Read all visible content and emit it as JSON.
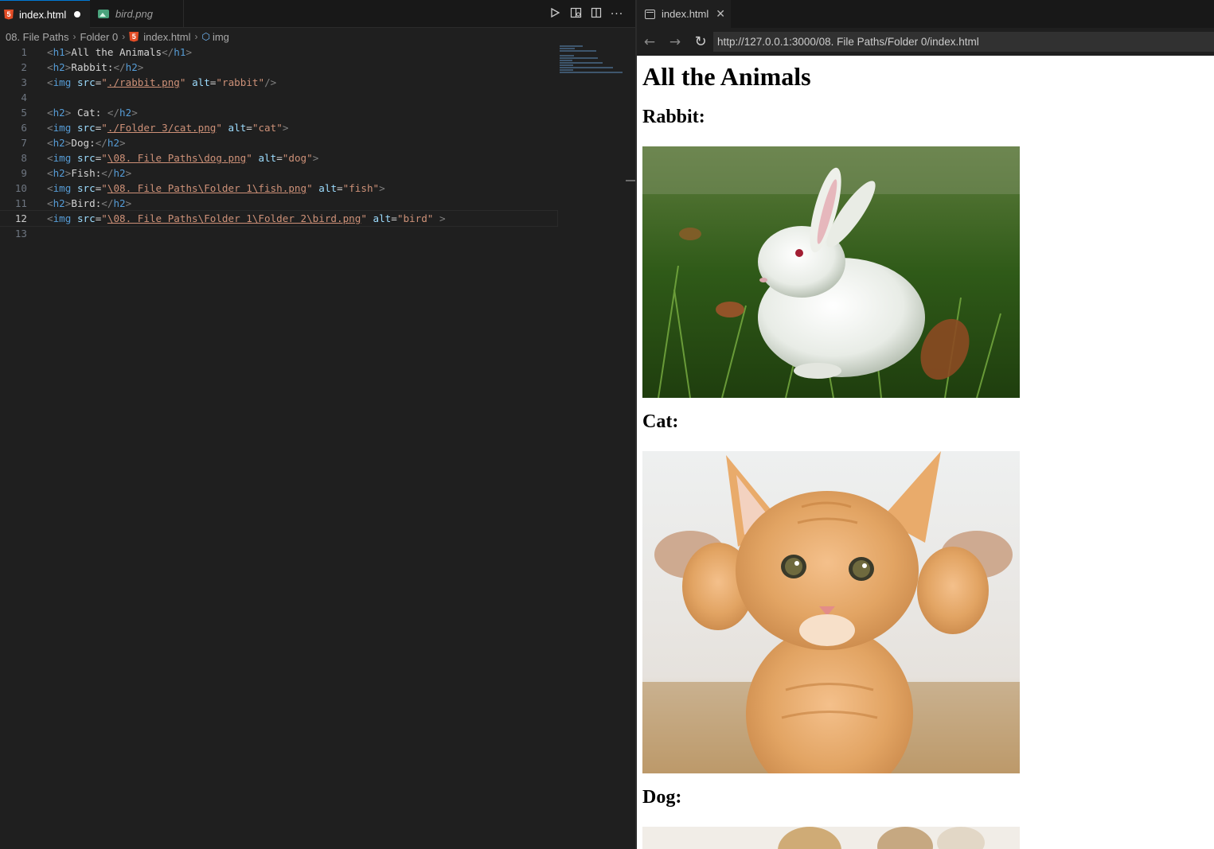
{
  "editor": {
    "tabs": [
      {
        "label": "index.html",
        "icon": "html5-icon",
        "dirty": true,
        "active": true
      },
      {
        "label": "bird.png",
        "icon": "image-file-icon",
        "active": false
      }
    ],
    "actions": [
      "run-icon",
      "open-preview-icon",
      "split-editor-icon",
      "more-actions-icon"
    ],
    "breadcrumb": [
      "08. File Paths",
      "Folder 0",
      "index.html",
      "img"
    ],
    "active_line": 12,
    "lines": [
      {
        "n": "1",
        "tokens": [
          [
            "br",
            "<"
          ],
          [
            "tag",
            "h1"
          ],
          [
            "br",
            ">"
          ],
          [
            "txt",
            "All the Animals"
          ],
          [
            "br",
            "</"
          ],
          [
            "tag",
            "h1"
          ],
          [
            "br",
            ">"
          ]
        ]
      },
      {
        "n": "2",
        "tokens": [
          [
            "br",
            "<"
          ],
          [
            "tag",
            "h2"
          ],
          [
            "br",
            ">"
          ],
          [
            "txt",
            "Rabbit:"
          ],
          [
            "br",
            "</"
          ],
          [
            "tag",
            "h2"
          ],
          [
            "br",
            ">"
          ]
        ]
      },
      {
        "n": "3",
        "tokens": [
          [
            "br",
            "<"
          ],
          [
            "tag",
            "img"
          ],
          [
            "txt",
            " "
          ],
          [
            "attr",
            "src"
          ],
          [
            "txt",
            "="
          ],
          [
            "str",
            "\""
          ],
          [
            "path",
            "./rabbit.png"
          ],
          [
            "str",
            "\""
          ],
          [
            "txt",
            " "
          ],
          [
            "attr",
            "alt"
          ],
          [
            "txt",
            "="
          ],
          [
            "str",
            "\"rabbit\""
          ],
          [
            "br",
            "/>"
          ]
        ]
      },
      {
        "n": "4",
        "tokens": []
      },
      {
        "n": "5",
        "tokens": [
          [
            "br",
            "<"
          ],
          [
            "tag",
            "h2"
          ],
          [
            "br",
            ">"
          ],
          [
            "txt",
            " Cat: "
          ],
          [
            "br",
            "</"
          ],
          [
            "tag",
            "h2"
          ],
          [
            "br",
            ">"
          ]
        ]
      },
      {
        "n": "6",
        "tokens": [
          [
            "br",
            "<"
          ],
          [
            "tag",
            "img"
          ],
          [
            "txt",
            " "
          ],
          [
            "attr",
            "src"
          ],
          [
            "txt",
            "="
          ],
          [
            "str",
            "\""
          ],
          [
            "path",
            "./Folder 3/cat.png"
          ],
          [
            "str",
            "\""
          ],
          [
            "txt",
            " "
          ],
          [
            "attr",
            "alt"
          ],
          [
            "txt",
            "="
          ],
          [
            "str",
            "\"cat\""
          ],
          [
            "br",
            ">"
          ]
        ]
      },
      {
        "n": "7",
        "tokens": [
          [
            "br",
            "<"
          ],
          [
            "tag",
            "h2"
          ],
          [
            "br",
            ">"
          ],
          [
            "txt",
            "Dog:"
          ],
          [
            "br",
            "</"
          ],
          [
            "tag",
            "h2"
          ],
          [
            "br",
            ">"
          ]
        ]
      },
      {
        "n": "8",
        "tokens": [
          [
            "br",
            "<"
          ],
          [
            "tag",
            "img"
          ],
          [
            "txt",
            " "
          ],
          [
            "attr",
            "src"
          ],
          [
            "txt",
            "="
          ],
          [
            "str",
            "\""
          ],
          [
            "path",
            "\\08. File Paths\\dog.png"
          ],
          [
            "str",
            "\""
          ],
          [
            "txt",
            " "
          ],
          [
            "attr",
            "alt"
          ],
          [
            "txt",
            "="
          ],
          [
            "str",
            "\"dog\""
          ],
          [
            "br",
            ">"
          ]
        ]
      },
      {
        "n": "9",
        "tokens": [
          [
            "br",
            "<"
          ],
          [
            "tag",
            "h2"
          ],
          [
            "br",
            ">"
          ],
          [
            "txt",
            "Fish:"
          ],
          [
            "br",
            "</"
          ],
          [
            "tag",
            "h2"
          ],
          [
            "br",
            ">"
          ]
        ]
      },
      {
        "n": "10",
        "tokens": [
          [
            "br",
            "<"
          ],
          [
            "tag",
            "img"
          ],
          [
            "txt",
            " "
          ],
          [
            "attr",
            "src"
          ],
          [
            "txt",
            "="
          ],
          [
            "str",
            "\""
          ],
          [
            "path",
            "\\08. File Paths\\Folder 1\\fish.png"
          ],
          [
            "str",
            "\""
          ],
          [
            "txt",
            " "
          ],
          [
            "attr",
            "alt"
          ],
          [
            "txt",
            "="
          ],
          [
            "str",
            "\"fish\""
          ],
          [
            "br",
            ">"
          ]
        ]
      },
      {
        "n": "11",
        "tokens": [
          [
            "br",
            "<"
          ],
          [
            "tag",
            "h2"
          ],
          [
            "br",
            ">"
          ],
          [
            "txt",
            "Bird:"
          ],
          [
            "br",
            "</"
          ],
          [
            "tag",
            "h2"
          ],
          [
            "br",
            ">"
          ]
        ]
      },
      {
        "n": "12",
        "tokens": [
          [
            "br",
            "<"
          ],
          [
            "tag",
            "img"
          ],
          [
            "txt",
            " "
          ],
          [
            "attr",
            "src"
          ],
          [
            "txt",
            "="
          ],
          [
            "str",
            "\""
          ],
          [
            "path",
            "\\08. File Paths\\Folder 1\\Folder 2\\bird.png"
          ],
          [
            "str",
            "\""
          ],
          [
            "txt",
            " "
          ],
          [
            "attr",
            "alt"
          ],
          [
            "txt",
            "="
          ],
          [
            "str",
            "\"bird\""
          ],
          [
            "txt",
            " "
          ],
          [
            "br",
            ">"
          ]
        ]
      },
      {
        "n": "13",
        "tokens": []
      }
    ]
  },
  "browser": {
    "tab_label": "index.html",
    "url": "http://127.0.0.1:3000/08. File Paths/Folder 0/index.html",
    "page": {
      "h1": "All the Animals",
      "headings": [
        "Rabbit:",
        "Cat:",
        "Dog:"
      ]
    }
  },
  "colors": {
    "editor_bg": "#1f1f1f",
    "tag": "#569cd6",
    "attr": "#9cdcfe",
    "string": "#ce9178",
    "accent": "#0078d4"
  }
}
